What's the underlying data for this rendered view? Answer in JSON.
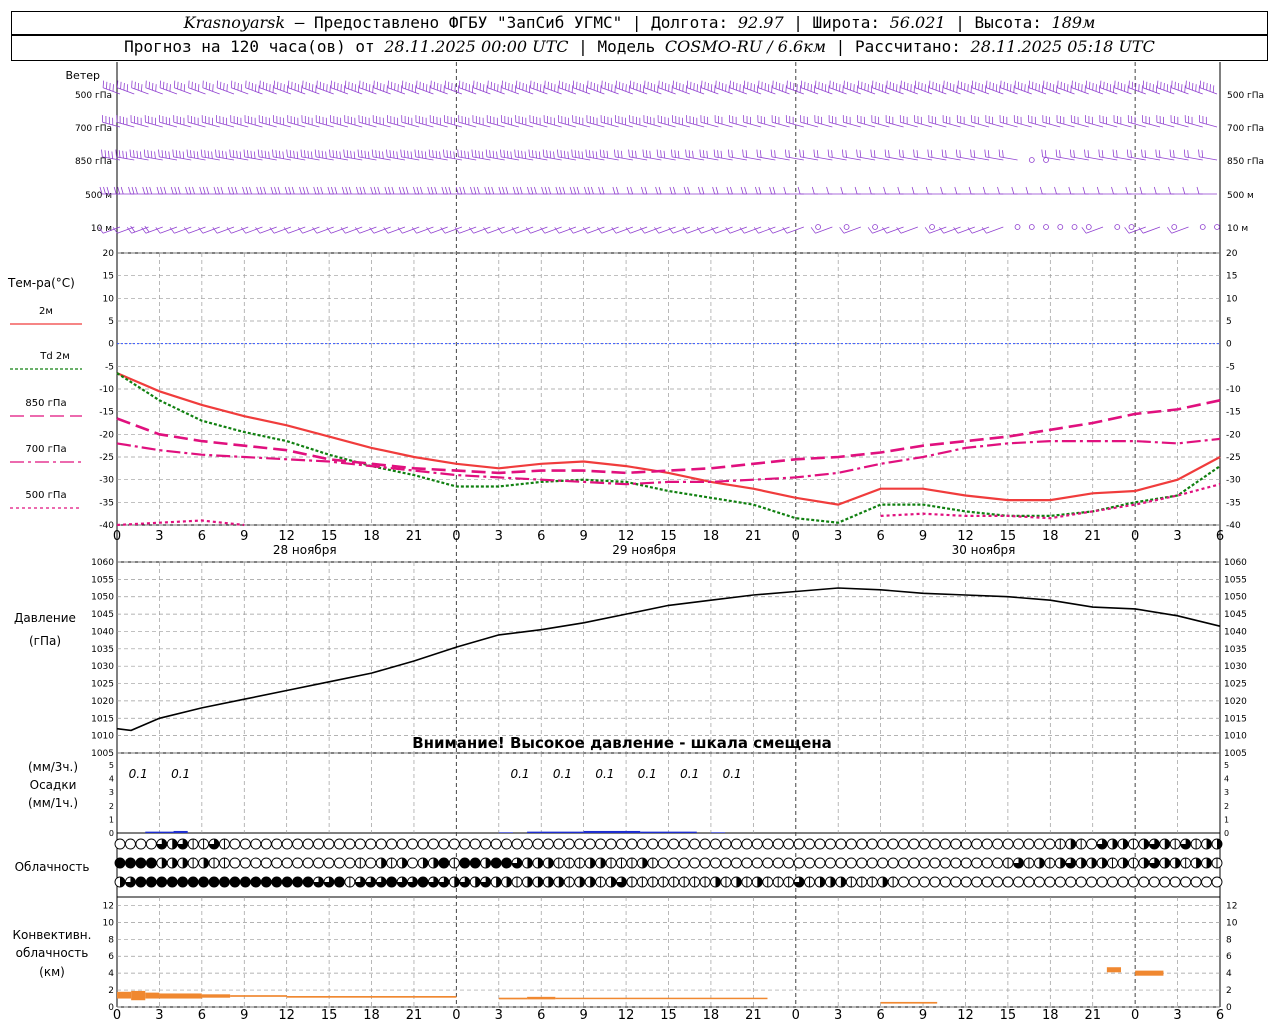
{
  "header": {
    "city": "Krasnoyarsk",
    "provider": " — Предоставлено ФГБУ \"ЗапСиб УГМС\" | Долгота: ",
    "lon": "92.97",
    "lat_label": " | Широта: ",
    "lat": "56.021",
    "alt_label": " | Высота: ",
    "alt": "189м",
    "forecast_label": "Прогноз на 120 часа(ов) от ",
    "forecast_from": "28.11.2025 00:00 UTC",
    "model_label": " | Модель ",
    "model": "COSMO-RU / 6.6км",
    "computed_label": " | Рассчитано: ",
    "computed": "28.11.2025 05:18 UTC"
  },
  "labels": {
    "wind": "Ветер",
    "wind_levels": [
      "500 гПа",
      "700 гПа",
      "850 гПа",
      "500 м",
      "10 м"
    ],
    "temp": "Тем-ра(°С)",
    "legend": [
      "2м",
      "Td 2м",
      "850 гПа",
      "700 гПа",
      "500 гПа"
    ],
    "pressure": [
      "Давление",
      "(гПа)"
    ],
    "warning": "Внимание! Высокое давление - шкала смещена",
    "precip": [
      "(мм/3ч.)",
      "Осадки",
      "(мм/1ч.)"
    ],
    "cloud": "Облачность",
    "conv": [
      "Конвективн.",
      "облачность",
      "(км)"
    ]
  },
  "x_ticks": [
    "0",
    "3",
    "6",
    "9",
    "12",
    "15",
    "18",
    "21",
    "0",
    "3",
    "6",
    "9",
    "12",
    "15",
    "18",
    "21",
    "0",
    "3",
    "6",
    "9",
    "12",
    "15",
    "18",
    "21",
    "0",
    "3",
    "6"
  ],
  "days": [
    "28 ноября",
    "29 ноября",
    "30 ноября"
  ],
  "colors": {
    "t2m": "#f03c3c",
    "td": "#108010",
    "t850": "#e0107e",
    "t700": "#e0107e",
    "t500": "#e0107e",
    "wind": "#9040d0",
    "pressure": "#000000",
    "precip": "#1e2ed0",
    "conv": "#f08830",
    "grid": "#9a9a9a"
  },
  "chart_data": [
    {
      "type": "line",
      "title": "Тем-ра(°С)",
      "xlabel": "",
      "ylabel": "Тем-ра(°С)",
      "x_hours": [
        0,
        3,
        6,
        9,
        12,
        15,
        18,
        21,
        24,
        27,
        30,
        33,
        36,
        39,
        42,
        45,
        48,
        51,
        54,
        57,
        60,
        63,
        66,
        69,
        72,
        75,
        78
      ],
      "ylim": [
        -40,
        20
      ],
      "yticks": [
        20,
        15,
        10,
        5,
        0,
        -5,
        -10,
        -15,
        -20,
        -25,
        -30,
        -35,
        -40
      ],
      "series": [
        {
          "name": "2м",
          "values": [
            -6.5,
            -10.5,
            -13.5,
            -16,
            -18,
            -20.5,
            -23,
            -25,
            -26.5,
            -27.5,
            -26.5,
            -26,
            -27,
            -28.5,
            -30.5,
            -32,
            -34,
            -35.5,
            -32,
            -32,
            -33.5,
            -34.5,
            -34.5,
            -33,
            -32.5,
            -30,
            -25
          ]
        },
        {
          "name": "Td 2м",
          "values": [
            -6.5,
            -12.5,
            -17,
            -19.5,
            -21.5,
            -24.5,
            -27,
            -29,
            -31.5,
            -31.5,
            -30.5,
            -30,
            -30.5,
            -32.5,
            -34,
            -35.5,
            -38.5,
            -39.5,
            -35.5,
            -35.5,
            -37,
            -38,
            -38,
            -37,
            -35,
            -33.5,
            -27
          ]
        },
        {
          "name": "850 гПа",
          "values": [
            -16.5,
            -20,
            -21.5,
            -22.5,
            -23.5,
            -25.5,
            -26.5,
            -27.5,
            -28,
            -28.5,
            -28,
            -28,
            -28.5,
            -28,
            -27.5,
            -26.5,
            -25.5,
            -25,
            -24,
            -22.5,
            -21.5,
            -20.5,
            -19,
            -17.5,
            -15.5,
            -14.5,
            -12.5
          ]
        },
        {
          "name": "700 гПа",
          "values": [
            -22,
            -23.5,
            -24.5,
            -25,
            -25.5,
            -26,
            -27,
            -28,
            -29,
            -29.5,
            -30,
            -30.5,
            -31,
            -30.5,
            -30.5,
            -30,
            -29.5,
            -28.5,
            -26.5,
            -25,
            -23,
            -22,
            -21.5,
            -21.5,
            -21.5,
            -22,
            -21
          ]
        },
        {
          "name": "500 гПа",
          "values": [
            -40,
            -39.5,
            -39,
            -40,
            null,
            null,
            null,
            null,
            null,
            null,
            null,
            null,
            null,
            null,
            null,
            null,
            null,
            null,
            -38,
            -37.5,
            -38,
            -38,
            -38.5,
            -37,
            -35.5,
            -33.5,
            -31
          ]
        }
      ]
    },
    {
      "type": "line",
      "title": "Давление (гПа)",
      "xlabel": "",
      "ylabel": "Давление (гПа)",
      "x_hours": [
        0,
        1,
        3,
        6,
        9,
        12,
        15,
        18,
        21,
        24,
        27,
        30,
        33,
        36,
        39,
        42,
        45,
        48,
        51,
        54,
        57,
        60,
        63,
        66,
        69,
        72,
        75,
        78
      ],
      "ylim": [
        1005,
        1060
      ],
      "yticks": [
        1060,
        1055,
        1050,
        1045,
        1040,
        1035,
        1030,
        1025,
        1020,
        1015,
        1010,
        1005
      ],
      "series": [
        {
          "name": "Давление",
          "values": [
            1012,
            1011.5,
            1015,
            1018,
            1020.5,
            1023,
            1025.5,
            1028,
            1031.5,
            1035.5,
            1039,
            1040.5,
            1042.5,
            1045,
            1047.5,
            1049,
            1050.5,
            1051.5,
            1052.5,
            1052,
            1051,
            1050.5,
            1050,
            1049,
            1047,
            1046.5,
            1044.5,
            1041.5
          ]
        }
      ]
    },
    {
      "type": "bar",
      "title": "Осадки",
      "xlabel": "",
      "ylabel": "(мм/1ч.)",
      "ylim": [
        0,
        5
      ],
      "yticks": [
        5,
        4,
        3,
        2,
        1,
        0
      ],
      "labels_3h": [
        {
          "hour": 1.5,
          "text": "0.1"
        },
        {
          "hour": 4.5,
          "text": "0.1"
        },
        {
          "hour": 28.5,
          "text": "0.1"
        },
        {
          "hour": 31.5,
          "text": "0.1"
        },
        {
          "hour": 34.5,
          "text": "0.1"
        },
        {
          "hour": 37.5,
          "text": "0.1"
        },
        {
          "hour": 40.5,
          "text": "0.1"
        },
        {
          "hour": 43.5,
          "text": "0.1"
        }
      ],
      "bars": [
        {
          "start": 2,
          "end": 4,
          "value": 0.1
        },
        {
          "start": 4,
          "end": 5,
          "value": 0.15
        },
        {
          "start": 27,
          "end": 28,
          "value": 0.05
        },
        {
          "start": 29,
          "end": 33,
          "value": 0.1
        },
        {
          "start": 33,
          "end": 37,
          "value": 0.15
        },
        {
          "start": 37,
          "end": 41,
          "value": 0.1
        },
        {
          "start": 42,
          "end": 43,
          "value": 0.05
        }
      ]
    },
    {
      "type": "bar",
      "title": "Конвективн. облачность (км)",
      "xlabel": "",
      "ylabel": "(км)",
      "ylim": [
        0,
        13
      ],
      "yticks": [
        12,
        10,
        8,
        6,
        4,
        2,
        0
      ],
      "bars": [
        {
          "start": 0,
          "end": 1,
          "bottom": 1.0,
          "top": 1.8
        },
        {
          "start": 1,
          "end": 2,
          "bottom": 0.8,
          "top": 1.9
        },
        {
          "start": 2,
          "end": 3,
          "bottom": 1.0,
          "top": 1.7
        },
        {
          "start": 3,
          "end": 6,
          "bottom": 1.0,
          "top": 1.6
        },
        {
          "start": 6,
          "end": 8,
          "bottom": 1.1,
          "top": 1.5
        },
        {
          "start": 8,
          "end": 12,
          "bottom": 1.2,
          "top": 1.4
        },
        {
          "start": 12,
          "end": 24,
          "bottom": 1.1,
          "top": 1.3
        },
        {
          "start": 27,
          "end": 29,
          "bottom": 0.9,
          "top": 1.1
        },
        {
          "start": 29,
          "end": 31,
          "bottom": 0.9,
          "top": 1.2
        },
        {
          "start": 31,
          "end": 46,
          "bottom": 1.0,
          "top": 1.1
        },
        {
          "start": 54,
          "end": 58,
          "bottom": 0.4,
          "top": 0.6
        },
        {
          "start": 70,
          "end": 71,
          "bottom": 4.1,
          "top": 4.7
        },
        {
          "start": 72,
          "end": 74,
          "bottom": 3.7,
          "top": 4.3
        }
      ]
    }
  ],
  "cloud_rows": [
    "0000323113100000000000000000000000000000000000000000000000000000000000000000000000000000001210322123213122",
    "4444222121100000000000010212022414424432221112211121000000000000000000000000000000000131212322212123221221",
    "2344444444444444444334133343343323232212222122123111111112121211131222111210000000000000000000000000000000"
  ],
  "wind": {
    "note": "direction in degrees (from), speed class 0-5; rows 500hPa,700hPa,850hPa,500m,10m",
    "rows": [
      {
        "dir": 290,
        "speed": [
          4,
          4,
          4,
          4,
          4,
          4,
          4,
          4,
          4,
          4,
          5,
          5,
          5,
          5,
          5,
          5,
          5,
          5,
          5,
          5,
          5,
          5,
          5,
          5,
          5,
          5,
          5,
          5,
          5,
          5,
          5,
          5,
          5,
          5,
          5,
          5,
          5,
          5,
          5,
          5,
          5,
          5,
          5,
          5,
          5,
          5,
          5,
          5,
          5,
          5,
          5,
          5,
          5,
          5,
          5,
          5,
          5,
          5,
          5,
          5,
          5,
          5,
          5,
          5,
          5,
          5,
          5,
          5,
          5,
          5,
          5,
          5,
          5,
          5,
          5,
          5,
          5,
          5
        ]
      },
      {
        "dir": 285,
        "speed": [
          4,
          4,
          4,
          4,
          4,
          4,
          4,
          4,
          4,
          4,
          4,
          4,
          4,
          4,
          4,
          4,
          4,
          4,
          4,
          4,
          4,
          4,
          4,
          4,
          4,
          4,
          4,
          4,
          4,
          4,
          4,
          4,
          4,
          4,
          4,
          4,
          4,
          4,
          4,
          4,
          4,
          4,
          3,
          3,
          3,
          3,
          3,
          3,
          3,
          3,
          3,
          3,
          3,
          3,
          3,
          3,
          3,
          3,
          3,
          3,
          3,
          3,
          3,
          3,
          3,
          3,
          3,
          3,
          3,
          3,
          3,
          3,
          3,
          3,
          3,
          3,
          3,
          3
        ]
      },
      {
        "dir": 280,
        "speed": [
          4,
          4,
          4,
          4,
          4,
          4,
          4,
          4,
          4,
          4,
          4,
          4,
          4,
          4,
          4,
          4,
          4,
          4,
          4,
          4,
          4,
          4,
          4,
          4,
          4,
          4,
          4,
          4,
          4,
          4,
          4,
          4,
          4,
          4,
          4,
          3,
          3,
          3,
          3,
          3,
          3,
          3,
          3,
          3,
          2,
          2,
          2,
          2,
          2,
          2,
          2,
          2,
          2,
          2,
          2,
          2,
          2,
          2,
          2,
          2,
          2,
          2,
          2,
          2,
          0,
          0,
          2,
          2,
          2,
          2,
          2,
          2,
          2,
          2,
          2,
          2,
          2,
          2
        ]
      },
      {
        "dir": 270,
        "speed": [
          3,
          3,
          3,
          3,
          3,
          3,
          3,
          3,
          3,
          3,
          3,
          3,
          3,
          3,
          3,
          3,
          3,
          3,
          3,
          3,
          3,
          3,
          3,
          3,
          3,
          3,
          3,
          3,
          3,
          3,
          3,
          3,
          3,
          3,
          3,
          2,
          2,
          2,
          2,
          2,
          2,
          2,
          2,
          2,
          2,
          2,
          2,
          2,
          1,
          1,
          1,
          1,
          1,
          1,
          1,
          1,
          1,
          1,
          1,
          1,
          1,
          1,
          1,
          1,
          1,
          1,
          1,
          1,
          1,
          1,
          1,
          1,
          1,
          1,
          1,
          1,
          1,
          1
        ]
      },
      {
        "dir": 250,
        "speed": [
          1,
          1,
          2,
          2,
          1,
          1,
          1,
          1,
          1,
          1,
          1,
          1,
          1,
          1,
          1,
          1,
          1,
          1,
          1,
          1,
          1,
          1,
          1,
          1,
          1,
          1,
          1,
          1,
          1,
          1,
          1,
          1,
          1,
          1,
          1,
          1,
          1,
          1,
          1,
          1,
          1,
          1,
          1,
          1,
          1,
          1,
          1,
          1,
          1,
          0,
          1,
          0,
          1,
          0,
          1,
          1,
          1,
          0,
          1,
          1,
          1,
          1,
          1,
          0,
          0,
          0,
          0,
          0,
          0,
          1,
          0,
          0,
          1,
          1,
          0,
          1,
          0,
          0
        ]
      }
    ]
  }
}
